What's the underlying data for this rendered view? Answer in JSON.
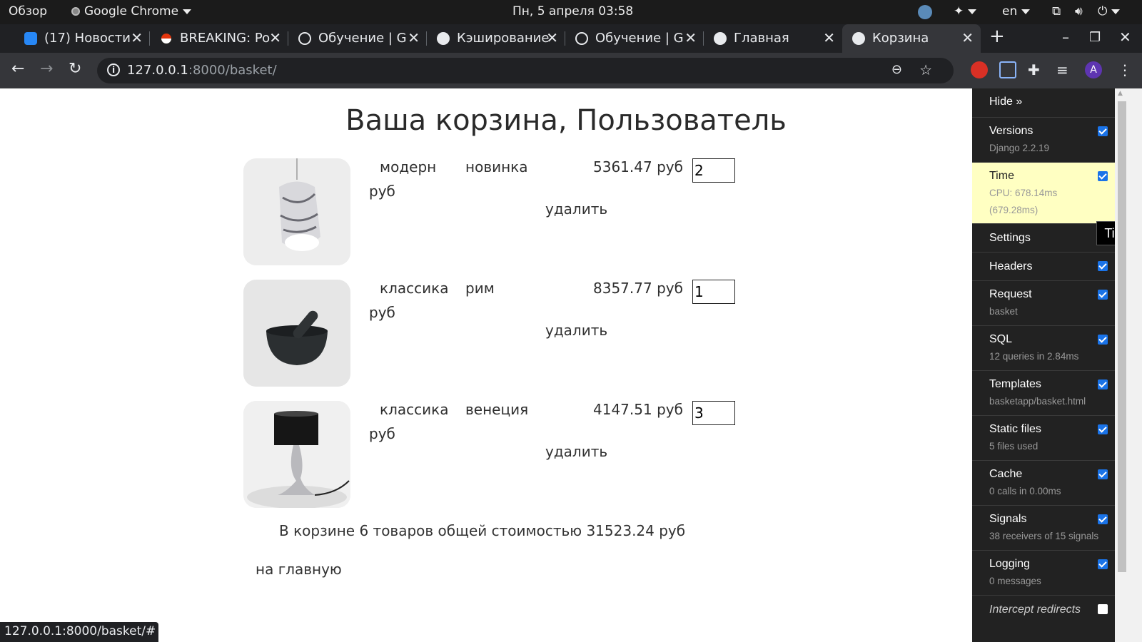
{
  "topbar": {
    "overview": "Обзор",
    "app_name": "Google Chrome",
    "clock": "Пн, 5 апреля  03:58",
    "lang": "en"
  },
  "tabs": [
    {
      "title": "(17) Новости",
      "favicon": "vk-icon",
      "color": "#2787f5"
    },
    {
      "title": "BREAKING: Po",
      "favicon": "pokeball-icon",
      "color": "#e3350d"
    },
    {
      "title": "Обучение | G",
      "favicon": "openai-icon",
      "color": "#e8eaed"
    },
    {
      "title": "Кэширование",
      "favicon": "globe-icon",
      "color": "#e8eaed"
    },
    {
      "title": "Обучение | G",
      "favicon": "openai-icon",
      "color": "#e8eaed"
    },
    {
      "title": "Главная",
      "favicon": "globe-icon",
      "color": "#e8eaed"
    },
    {
      "title": "Корзина",
      "favicon": "globe-icon",
      "color": "#e8eaed",
      "active": true
    }
  ],
  "address": {
    "host": "127.0.0.1",
    "path": ":8000/basket/"
  },
  "page": {
    "title": "Ваша корзина, Пользователь",
    "items": [
      {
        "category": "модерн",
        "name": "новинка",
        "price": "5361.47 руб",
        "currency": "руб",
        "quantity": "2",
        "delete_label": "удалить"
      },
      {
        "category": "классика",
        "name": "рим",
        "price": "8357.77 руб",
        "currency": "руб",
        "quantity": "1",
        "delete_label": "удалить"
      },
      {
        "category": "классика",
        "name": "венеция",
        "price": "4147.51 руб",
        "currency": "руб",
        "quantity": "3",
        "delete_label": "удалить"
      }
    ],
    "summary": "В корзине 6 товаров общей стоимостью 31523.24 руб",
    "home_link": "на главную"
  },
  "debug_toolbar": {
    "hide": "Hide »",
    "panels": [
      {
        "title": "Versions",
        "subtitle": "Django 2.2.19",
        "checked": true
      },
      {
        "title": "Time",
        "subtitle": "CPU: 678.14ms",
        "subtitle2": "(679.28ms)",
        "checked": true,
        "active": true
      },
      {
        "title": "Settings",
        "subtitle": "",
        "checked": false
      },
      {
        "title": "Headers",
        "subtitle": "",
        "checked": true
      },
      {
        "title": "Request",
        "subtitle": "basket",
        "checked": true
      },
      {
        "title": "SQL",
        "subtitle": "12 queries in 2.84ms",
        "checked": true
      },
      {
        "title": "Templates",
        "subtitle": "basketapp/basket.html",
        "checked": true
      },
      {
        "title": "Static files",
        "subtitle": "5 files used",
        "checked": true
      },
      {
        "title": "Cache",
        "subtitle": "0 calls in 0.00ms",
        "checked": true
      },
      {
        "title": "Signals",
        "subtitle": "38 receivers of 15 signals",
        "checked": true
      },
      {
        "title": "Logging",
        "subtitle": "0 messages",
        "checked": true
      },
      {
        "title": "Intercept redirects",
        "subtitle": "",
        "checked": false
      }
    ],
    "tooltip": "Time"
  },
  "status_bar": "127.0.0.1:8000/basket/#"
}
